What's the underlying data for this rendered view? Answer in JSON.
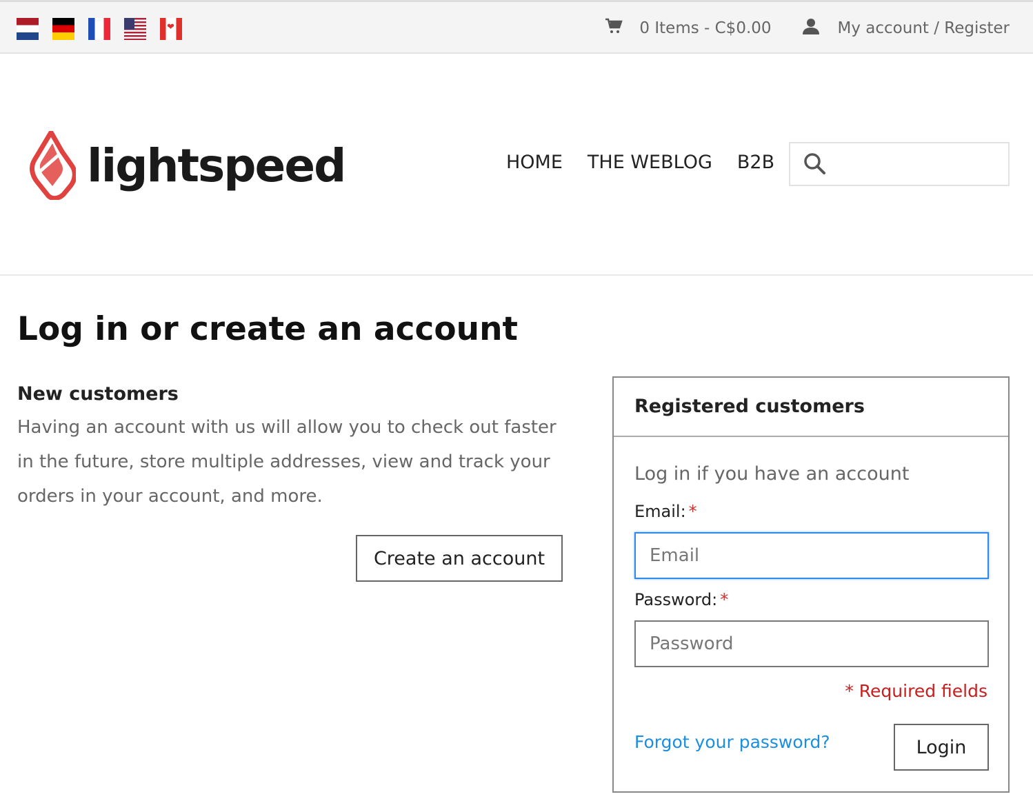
{
  "topbar": {
    "flags": [
      "Netherlands",
      "Germany",
      "France",
      "United States",
      "Canada"
    ],
    "cart_text": "0 Items - C$0.00",
    "account_text": "My account / Register"
  },
  "header": {
    "logo_text": "lightspeed",
    "nav": [
      "HOME",
      "THE WEBLOG",
      "B2B"
    ],
    "search_placeholder": ""
  },
  "main": {
    "page_title": "Log in or create an account",
    "new_customers": {
      "heading": "New customers",
      "text": "Having an account with us will allow you to check out faster in the future, store multiple addresses, view and track your orders in your account, and more.",
      "create_button": "Create an account"
    },
    "registered": {
      "heading": "Registered customers",
      "subheading": "Log in if you have an account",
      "email_label": "Email:",
      "email_placeholder": "Email",
      "password_label": "Password:",
      "password_placeholder": "Password",
      "required_asterisk": "*",
      "required_note": "* Required fields",
      "forgot_link": "Forgot your password?",
      "login_button": "Login"
    }
  },
  "colors": {
    "accent_blue": "#1c8ee0",
    "required_red": "#c81e1e",
    "logo_red": "#e0433f"
  }
}
